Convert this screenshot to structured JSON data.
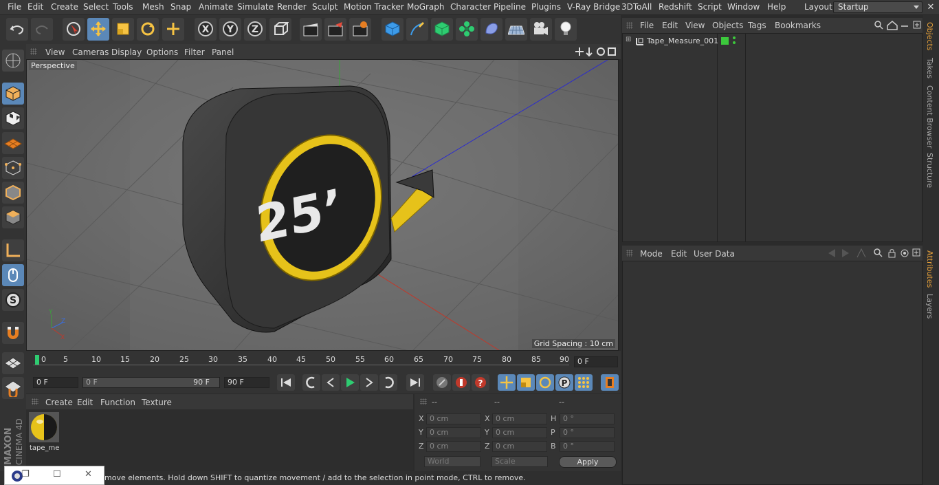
{
  "menu": [
    "File",
    "Edit",
    "Create",
    "Select",
    "Tools",
    "Mesh",
    "Snap",
    "Animate",
    "Simulate",
    "Render",
    "Sculpt",
    "Motion Tracker",
    "MoGraph",
    "Character",
    "Pipeline",
    "Plugins",
    "V-Ray Bridge",
    "3DToAll",
    "Redshift",
    "Script",
    "Window",
    "Help"
  ],
  "layout": {
    "label": "Layout:",
    "value": "Startup"
  },
  "viewport": {
    "menu": [
      "View",
      "Cameras",
      "Display",
      "Options",
      "Filter",
      "Panel"
    ],
    "label": "Perspective",
    "grid_spacing": "Grid Spacing : 10 cm",
    "model_text": "25’"
  },
  "timeline": {
    "ticks": [
      "0",
      "5",
      "10",
      "15",
      "20",
      "25",
      "30",
      "35",
      "40",
      "45",
      "50",
      "55",
      "60",
      "65",
      "70",
      "75",
      "80",
      "85",
      "90"
    ],
    "current": "0 F"
  },
  "transport": {
    "start": "0 F",
    "range_start": "0 F",
    "range_end": "90 F",
    "end": "90 F"
  },
  "material": {
    "menu": [
      "Create",
      "Edit",
      "Function",
      "Texture"
    ],
    "items": [
      {
        "name": "tape_me"
      }
    ]
  },
  "coords": {
    "headers": [
      "--",
      "--",
      "--"
    ],
    "rows": [
      {
        "a": "X",
        "av": "0 cm",
        "b": "X",
        "bv": "0 cm",
        "c": "H",
        "cv": "0 °"
      },
      {
        "a": "Y",
        "av": "0 cm",
        "b": "Y",
        "bv": "0 cm",
        "c": "P",
        "cv": "0 °"
      },
      {
        "a": "Z",
        "av": "0 cm",
        "b": "Z",
        "bv": "0 cm",
        "c": "B",
        "cv": "0 °"
      }
    ],
    "world": "World",
    "scale": "Scale",
    "apply": "Apply"
  },
  "status": "move elements. Hold down SHIFT to quantize movement / add to the selection in point mode, CTRL to remove.",
  "object_manager": {
    "menu": [
      "File",
      "Edit",
      "View",
      "Objects",
      "Tags",
      "Bookmarks"
    ],
    "objects": [
      {
        "name": "Tape_Measure_001",
        "color": "#3cc93c"
      }
    ]
  },
  "attributes": {
    "menu": [
      "Mode",
      "Edit",
      "User Data"
    ]
  },
  "right_tabs": [
    "Objects",
    "Takes",
    "Content Browser",
    "Structure"
  ],
  "right_tabs2": [
    "Attributes",
    "Layers"
  ],
  "brand": {
    "maxon": "MAXON",
    "product": "CINEMA 4D"
  },
  "colors": {
    "accent": "#5b88b8",
    "tab_active": "#e8a23a",
    "tape_yellow": "#e6c21a"
  }
}
